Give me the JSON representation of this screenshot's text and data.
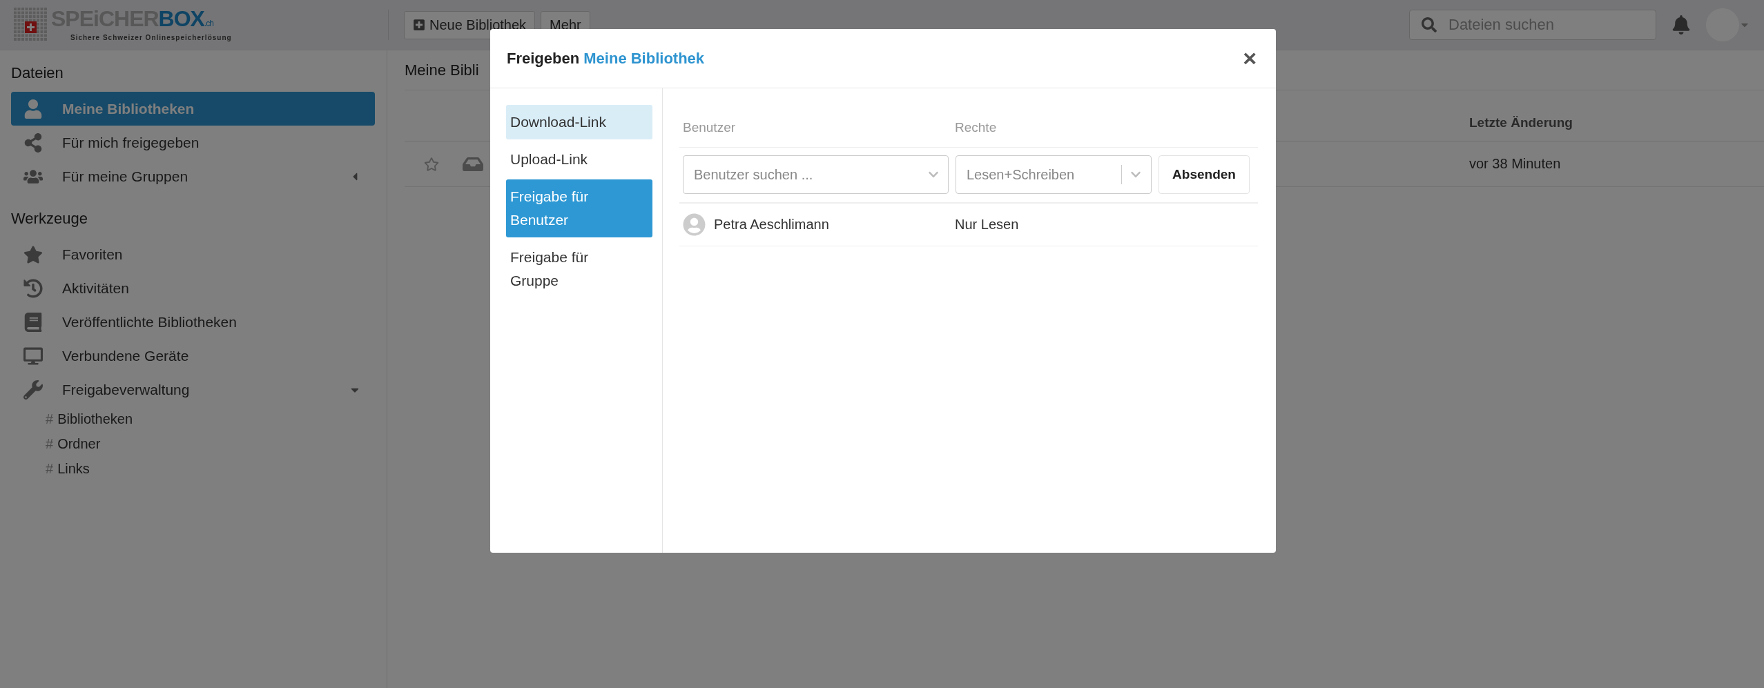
{
  "header": {
    "logo": {
      "word_left": "SPEiCHER",
      "word_right": "BOX",
      "suffix": ".ch",
      "tagline": "Sichere Schweizer Onlinespeicherlösung"
    },
    "buttons": [
      {
        "label": "Neue Bibliothek",
        "kind": "add"
      },
      {
        "label": "Mehr",
        "kind": "plain"
      }
    ],
    "search": {
      "placeholder": "Dateien suchen"
    }
  },
  "sidebar": {
    "sections": [
      {
        "title": "Dateien",
        "items": [
          {
            "label": "Meine Bibliotheken",
            "selected": true
          },
          {
            "label": "Für mich freigegeben",
            "selected": false
          },
          {
            "label": "Für meine Gruppen",
            "selected": false,
            "expanded": false
          }
        ]
      },
      {
        "title": "Werkzeuge",
        "items": [
          {
            "label": "Favoriten",
            "selected": false
          },
          {
            "label": "Aktivitäten",
            "selected": false
          },
          {
            "label": "Veröffentlichte Bibliotheken",
            "selected": false
          },
          {
            "label": "Verbundene Geräte",
            "selected": false
          },
          {
            "label": "Freigabeverwaltung",
            "selected": false,
            "expanded": true,
            "children": [
              {
                "mark": "#",
                "label": "Bibliotheken"
              },
              {
                "mark": "#",
                "label": "Ordner"
              },
              {
                "mark": "#",
                "label": "Links"
              }
            ]
          }
        ]
      }
    ]
  },
  "main": {
    "title": "Meine Bibli",
    "table": {
      "columns": [
        "Letzte Änderung"
      ],
      "rows": [
        {
          "starred": false,
          "modified": "vor 38 Minuten"
        }
      ]
    }
  },
  "dialog": {
    "title": "Freigeben",
    "library": "Meine Bibliothek",
    "close": "×",
    "nav": [
      {
        "label": "Download-Link",
        "selected": false,
        "hovered": true
      },
      {
        "label": "Upload-Link",
        "selected": false,
        "hovered": false
      },
      {
        "label": "Freigabe für Benutzer",
        "selected": true,
        "hovered": false
      },
      {
        "label": "Freigabe für Gruppe",
        "selected": false,
        "hovered": false
      }
    ],
    "columns": [
      "Benutzer",
      "Rechte"
    ],
    "user_field": {
      "placeholder": "Benutzer suchen ..."
    },
    "rights_field": {
      "value": "Lesen+Schreiben"
    },
    "submit": "Absenden",
    "shares": [
      {
        "name": "Petra Aeschlimann",
        "permission": "Nur Lesen"
      }
    ]
  }
}
